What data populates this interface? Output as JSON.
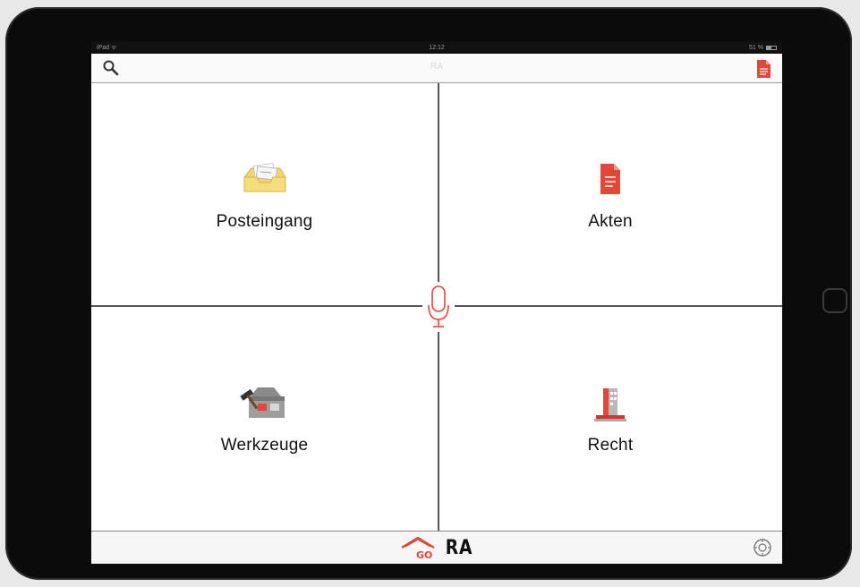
{
  "status_bar": {
    "carrier": "iPad ᯤ",
    "time": "12:12",
    "battery_text": "51 %",
    "battery_level": 0.51
  },
  "nav": {
    "title": "RA",
    "search_icon": "search-icon",
    "document_icon": "document-icon"
  },
  "tiles": [
    {
      "label": "Posteingang",
      "icon": "inbox-tray-icon"
    },
    {
      "label": "Akten",
      "icon": "file-icon"
    },
    {
      "label": "Werkzeuge",
      "icon": "toolbox-icon"
    },
    {
      "label": "Recht",
      "icon": "courthouse-icon"
    }
  ],
  "center": {
    "icon": "microphone-icon"
  },
  "footer": {
    "logo_text": "RA",
    "logo_badge": "GO",
    "settings_icon": "gear-icon"
  },
  "colors": {
    "accent": "#e2483a",
    "folder": "#f2d56a",
    "divider": "#555555"
  }
}
